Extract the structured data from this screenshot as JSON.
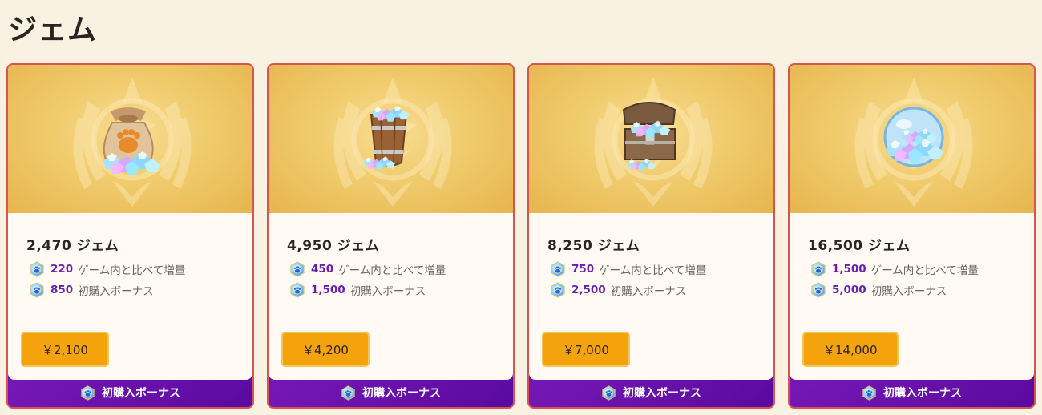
{
  "page": {
    "title": "ジェム"
  },
  "cards": [
    {
      "item_icon": "gem-pouch-icon",
      "amount": "2,470 ジェム",
      "bonus1_value": "220",
      "bonus1_label": "ゲーム内と比べて増量",
      "bonus2_value": "850",
      "bonus2_label": "初購入ボーナス",
      "price": "￥2,100",
      "banner": "初購入ボーナス"
    },
    {
      "item_icon": "gem-bucket-icon",
      "amount": "4,950 ジェム",
      "bonus1_value": "450",
      "bonus1_label": "ゲーム内と比べて増量",
      "bonus2_value": "1,500",
      "bonus2_label": "初購入ボーナス",
      "price": "￥4,200",
      "banner": "初購入ボーナス"
    },
    {
      "item_icon": "gem-chest-icon",
      "amount": "8,250 ジェム",
      "bonus1_value": "750",
      "bonus1_label": "ゲーム内と比べて増量",
      "bonus2_value": "2,500",
      "bonus2_label": "初購入ボーナス",
      "price": "￥7,000",
      "banner": "初購入ボーナス"
    },
    {
      "item_icon": "gem-globe-icon",
      "amount": "16,500 ジェム",
      "bonus1_value": "1,500",
      "bonus1_label": "ゲーム内と比べて増量",
      "bonus2_value": "5,000",
      "bonus2_label": "初購入ボーナス",
      "price": "￥14,000",
      "banner": "初購入ボーナス"
    }
  ],
  "colors": {
    "background": "#f9f1e2",
    "card_border": "#d9534f",
    "price_button": "#f5a30c",
    "bonus_number": "#6a1fb0",
    "banner_purple": "#7216b3"
  }
}
